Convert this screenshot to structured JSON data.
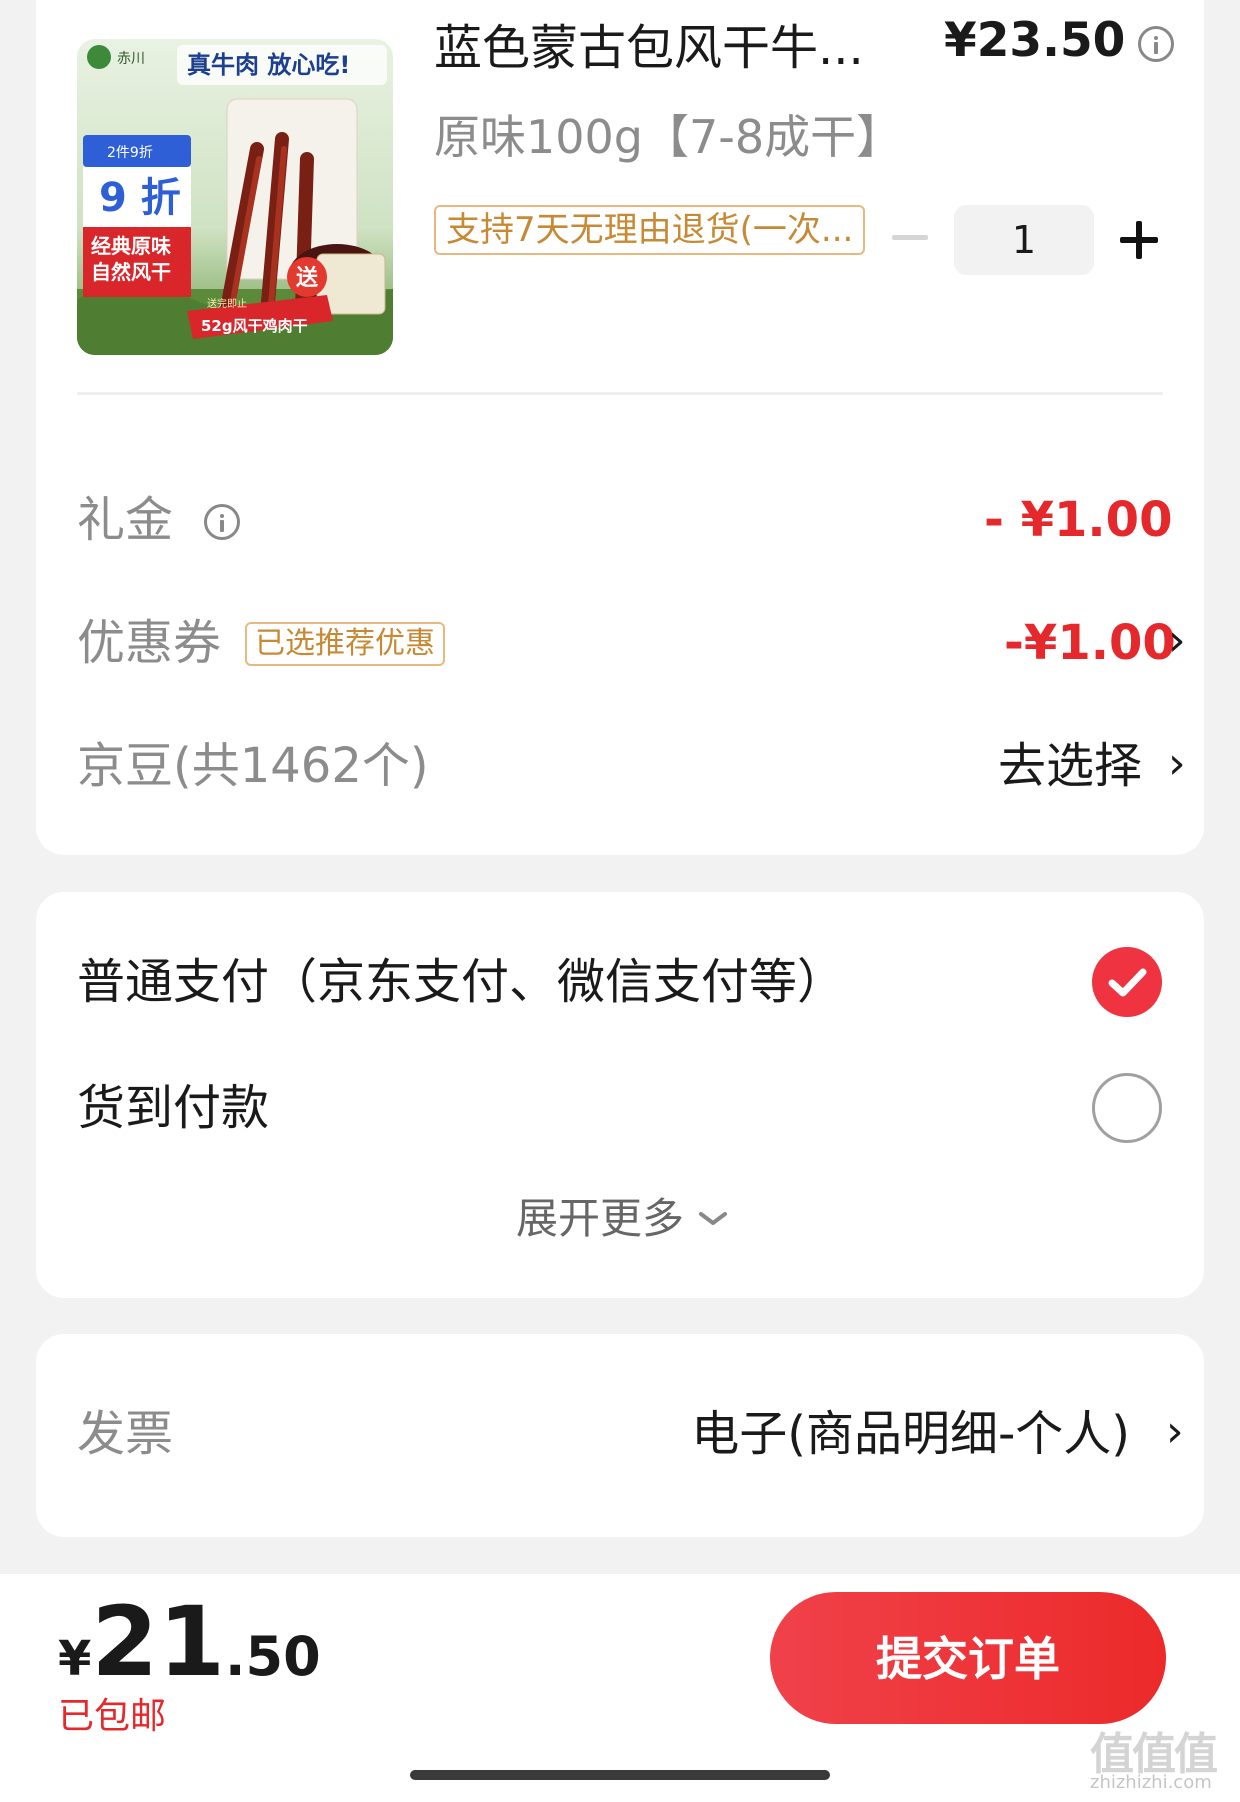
{
  "product": {
    "name": "蓝色蒙古包风干牛...",
    "price": "¥23.50",
    "spec": "原味100g【7-8成干】",
    "return_tag": "支持7天无理由退货(一次...",
    "quantity": "1",
    "image": {
      "brand": "赤川",
      "banner": "真牛肉 放心吃!",
      "promo_top": "2件9折",
      "promo_main": "9 折",
      "slogan_1": "经典原味",
      "slogan_2": "自然风干",
      "gift_badge": "送",
      "gift_text": "52g风干鸡肉干",
      "gift_small": "送完即止"
    }
  },
  "discounts": {
    "gift_label": "礼金",
    "gift_value": "- ¥1.00",
    "coupon_label": "优惠券",
    "coupon_tag": "已选推荐优惠",
    "coupon_value": "-¥1.00",
    "beans_label": "京豆(共1462个)",
    "beans_action": "去选择"
  },
  "payment": {
    "option_1": "普通支付（京东支付、微信支付等）",
    "option_2": "货到付款",
    "selected": "普通支付（京东支付、微信支付等）",
    "expand_label": "展开更多"
  },
  "invoice": {
    "label": "发票",
    "value": "电子(商品明细-个人)"
  },
  "footer": {
    "currency": "¥",
    "total_int": "21",
    "total_dec": ".50",
    "shipping": "已包邮",
    "submit_label": "提交订单"
  },
  "watermark": {
    "logo_text": "值值值",
    "url": "zhizhizhi.com"
  },
  "colors": {
    "accent_red": "#e4282b",
    "tag_gold": "#c88934",
    "background": "#f2f2f2"
  }
}
